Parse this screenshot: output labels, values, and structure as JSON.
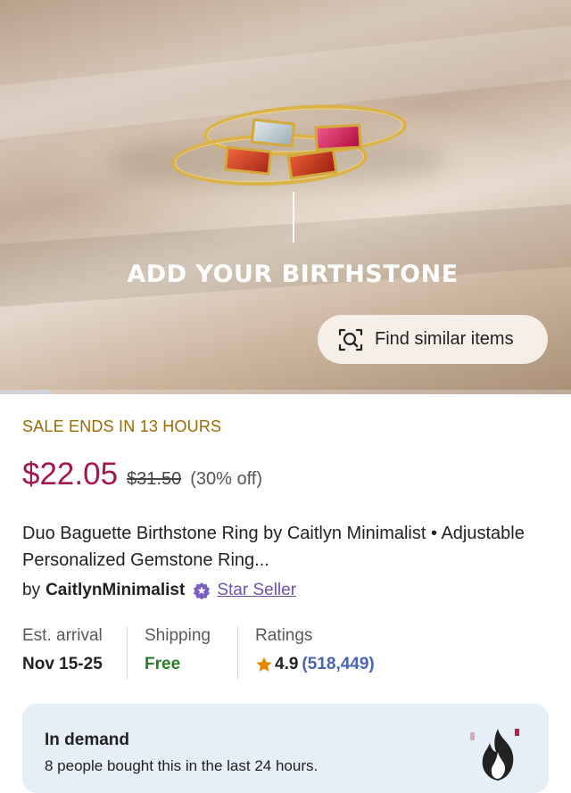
{
  "hero": {
    "headline": "ADD YOUR BIRTHSTONE",
    "find_button_label": "Find similar items",
    "image_progress": 0.09
  },
  "listing": {
    "sale_banner": "SALE ENDS IN 13 HOURS",
    "price": "$22.05",
    "original_price": "$31.50",
    "discount": "(30% off)",
    "title": "Duo Baguette Birthstone Ring by Caitlyn Minimalist • Adjustable Personalized Gemstone Ring...",
    "seller": {
      "prefix": "by",
      "shop_name": "CaitlynMinimalist",
      "badge": "Star Seller"
    },
    "facts": {
      "arrival_label": "Est. arrival",
      "arrival_value": "Nov 15-25",
      "shipping_label": "Shipping",
      "shipping_value": "Free",
      "ratings_label": "Ratings",
      "rating_value": "4.9",
      "rating_count": "(518,449)"
    },
    "demand": {
      "title": "In demand",
      "subtitle": "8 people bought this in the last 24 hours."
    }
  },
  "colors": {
    "sale_text": "#9a6a00",
    "price": "#a3174f",
    "star_seller": "#6e54a8",
    "free_shipping": "#2a7b2a",
    "rating_count": "#4a63b5",
    "star": "#e08a00",
    "demand_bg": "#e6eef8"
  },
  "icons": {
    "find_similar": "visual-search-icon",
    "star_seller": "star-seller-badge-icon",
    "rating": "star-icon",
    "demand": "fire-icon"
  }
}
